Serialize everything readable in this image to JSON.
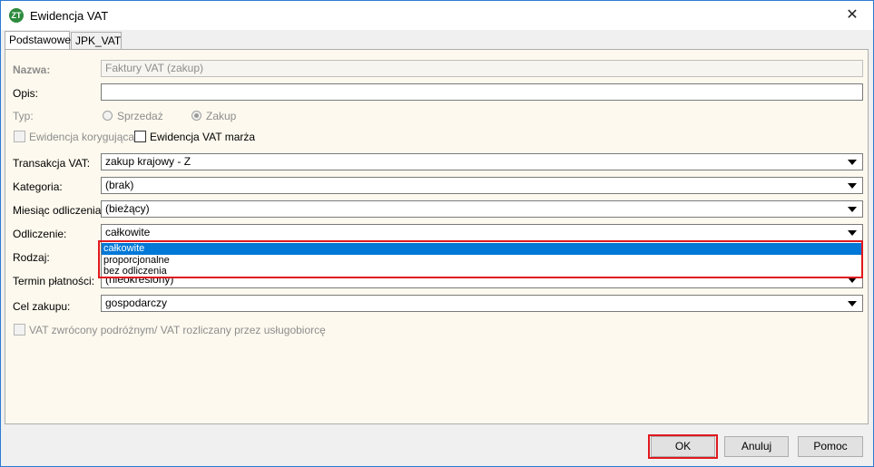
{
  "window": {
    "title": "Ewidencja VAT",
    "close_glyph": "✕",
    "app_icon_text": "ZT"
  },
  "tabs": [
    {
      "label": "Podstawowe",
      "active": true
    },
    {
      "label": "JPK_VAT",
      "active": false
    }
  ],
  "form": {
    "nazwa": {
      "label": "Nazwa:",
      "value": "Faktury VAT (zakup)"
    },
    "opis": {
      "label": "Opis:",
      "value": ""
    },
    "typ": {
      "label": "Typ:",
      "options": [
        "Sprzedaż",
        "Zakup"
      ],
      "selected": "Zakup"
    },
    "ewidencja_korygujaca": {
      "label": "Ewidencja korygująca",
      "checked": false
    },
    "ewidencja_marza": {
      "label": "Ewidencja VAT marża",
      "checked": false
    },
    "transakcja": {
      "label": "Transakcja VAT:",
      "value": "zakup krajowy - Z"
    },
    "kategoria": {
      "label": "Kategoria:",
      "value": "(brak)"
    },
    "miesiac": {
      "label": "Miesiąc odliczenia:",
      "value": "(bieżący)"
    },
    "odliczenie": {
      "label": "Odliczenie:",
      "value": "całkowite",
      "options": [
        "całkowite",
        "proporcjonalne",
        "bez odliczenia"
      ]
    },
    "rodzaj": {
      "label": "Rodzaj:"
    },
    "termin": {
      "label": "Termin płatności:",
      "value": "(nieokreślony)"
    },
    "cel": {
      "label": "Cel zakupu:",
      "value": "gospodarczy"
    },
    "vat_zwrocony": {
      "label": "VAT zwrócony podróżnym/ VAT rozliczany przez usługobiorcę",
      "checked": false
    }
  },
  "buttons": {
    "ok": "OK",
    "cancel": "Anuluj",
    "help": "Pomoc"
  },
  "colors": {
    "accent": "#0078d7",
    "highlight": "#e0191e",
    "panel_bg": "#fdf9ee"
  }
}
